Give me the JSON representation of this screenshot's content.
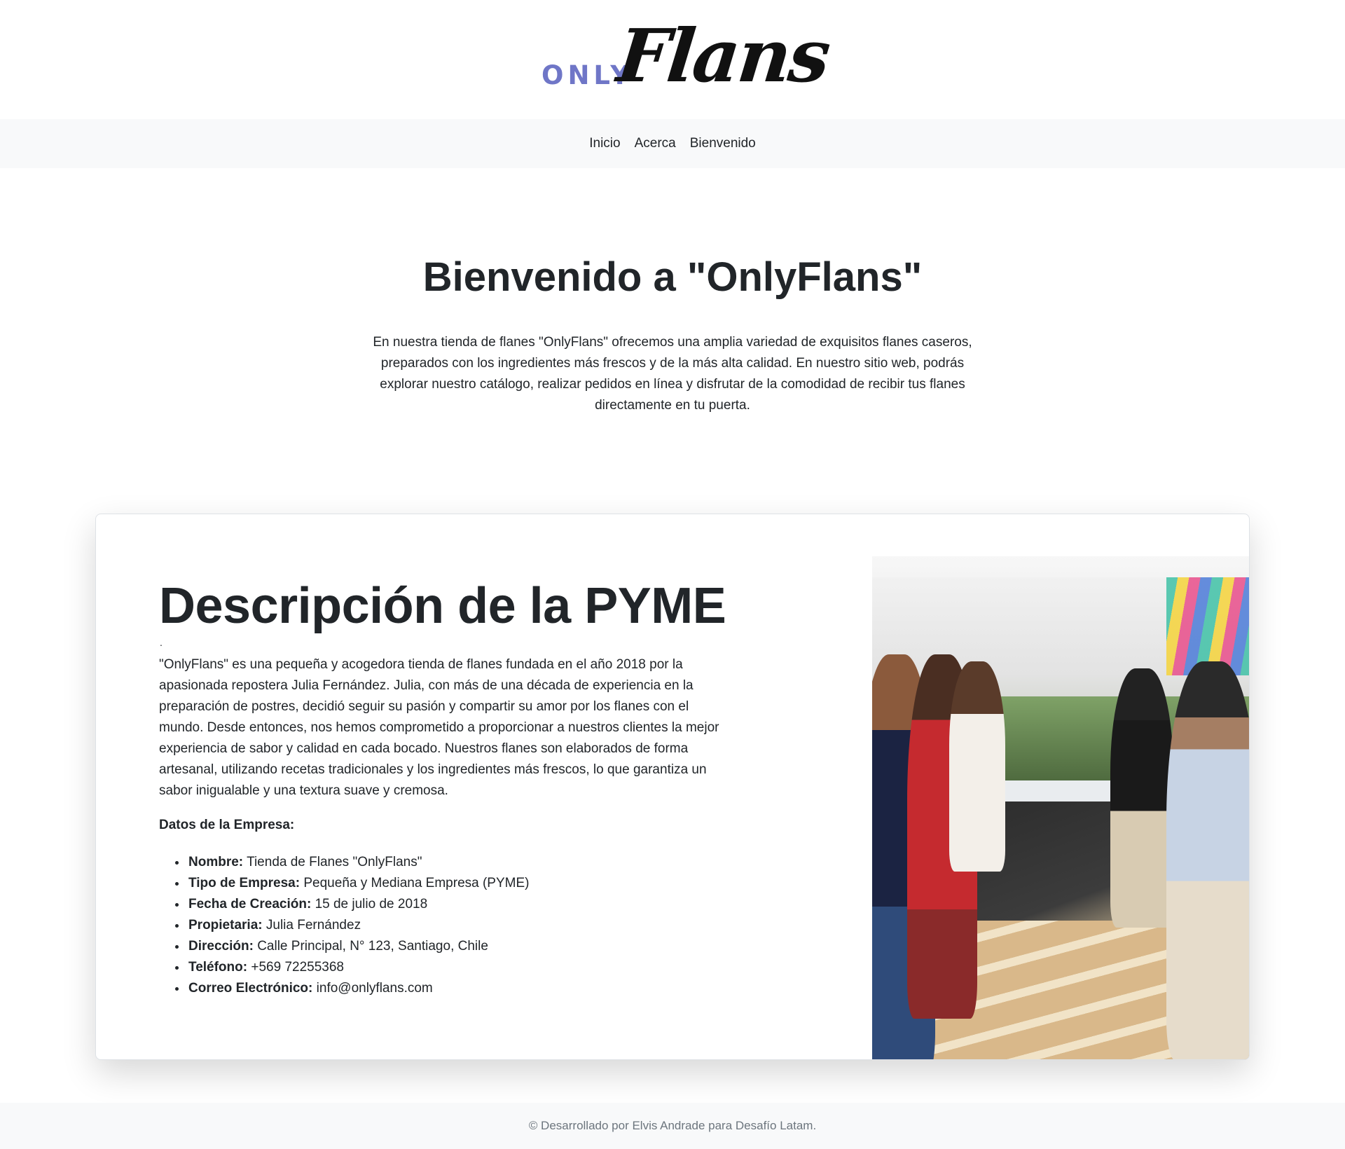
{
  "logo": {
    "prefix": "ONLY",
    "name": "Flans"
  },
  "nav": {
    "items": [
      {
        "label": "Inicio"
      },
      {
        "label": "Acerca"
      },
      {
        "label": "Bienvenido"
      }
    ]
  },
  "hero": {
    "title": "Bienvenido a \"OnlyFlans\"",
    "text": "En nuestra tienda de flanes \"OnlyFlans\" ofrecemos una amplia variedad de exquisitos flanes caseros, preparados con los ingredientes más frescos y de la más alta calidad. En nuestro sitio web, podrás explorar nuestro catálogo, realizar pedidos en línea y disfrutar de la comodidad de recibir tus flanes directamente en tu puerta."
  },
  "about": {
    "title": "Descripción de la PYME",
    "dot": ".",
    "text": "\"OnlyFlans\" es una pequeña y acogedora tienda de flanes fundada en el año 2018 por la apasionada repostera Julia Fernández. Julia, con más de una década de experiencia en la preparación de postres, decidió seguir su pasión y compartir su amor por los flanes con el mundo. Desde entonces, nos hemos comprometido a proporcionar a nuestros clientes la mejor experiencia de sabor y calidad en cada bocado. Nuestros flanes son elaborados de forma artesanal, utilizando recetas tradicionales y los ingredientes más frescos, lo que garantiza un sabor inigualable y una textura suave y cremosa.",
    "company_heading": "Datos de la Empresa:",
    "details": [
      {
        "label": "Nombre:",
        "value": "Tienda de Flanes \"OnlyFlans\""
      },
      {
        "label": "Tipo de Empresa:",
        "value": "Pequeña y Mediana Empresa (PYME)"
      },
      {
        "label": "Fecha de Creación:",
        "value": "15 de julio de 2018"
      },
      {
        "label": "Propietaria:",
        "value": "Julia Fernández"
      },
      {
        "label": "Dirección:",
        "value": "Calle Principal, N° 123, Santiago, Chile"
      },
      {
        "label": "Teléfono:",
        "value": "+569 72255368"
      },
      {
        "label": "Correo Electrónico:",
        "value": "info@onlyflans.com"
      }
    ]
  },
  "footer": {
    "text": "© Desarrollado por Elvis Andrade para Desafío Latam."
  },
  "colors": {
    "logo_accent": "#6f76c7",
    "nav_bg": "#f8f9fa",
    "text": "#212529"
  }
}
